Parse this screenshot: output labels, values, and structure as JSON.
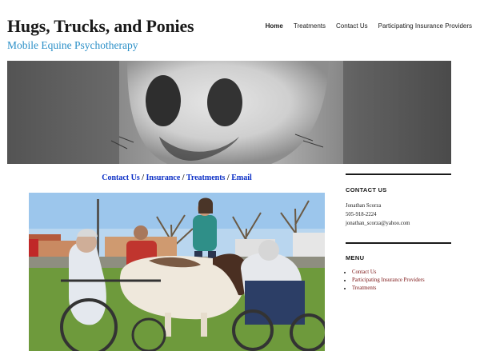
{
  "header": {
    "site_title": "Hugs, Trucks, and Ponies",
    "site_description": "Mobile Equine Psychotherapy"
  },
  "nav": {
    "items": [
      {
        "label": "Home"
      },
      {
        "label": "Treatments"
      },
      {
        "label": "Contact Us"
      },
      {
        "label": "Participating Insurance Providers"
      }
    ],
    "active": "Home"
  },
  "content": {
    "quick_links": [
      {
        "label": "Contact Us"
      },
      {
        "label": "Insurance"
      },
      {
        "label": "Treatments"
      },
      {
        "label": "Email"
      }
    ],
    "separator": " / "
  },
  "sidebar": {
    "contact": {
      "heading": "CONTACT US",
      "name": "Jonathan Scorza",
      "phone": "505-918-2224",
      "email": "jonathan_scorza@yahoo.com"
    },
    "menu": {
      "heading": "MENU",
      "items": [
        {
          "label": "Contact Us"
        },
        {
          "label": "Participating Insurance Providers"
        },
        {
          "label": "Treatments"
        }
      ]
    }
  },
  "colors": {
    "accent_blue": "#2a8fc7",
    "link_blue": "#0b2fc6",
    "link_maroon": "#7a1212",
    "text": "#1a1a1a"
  }
}
